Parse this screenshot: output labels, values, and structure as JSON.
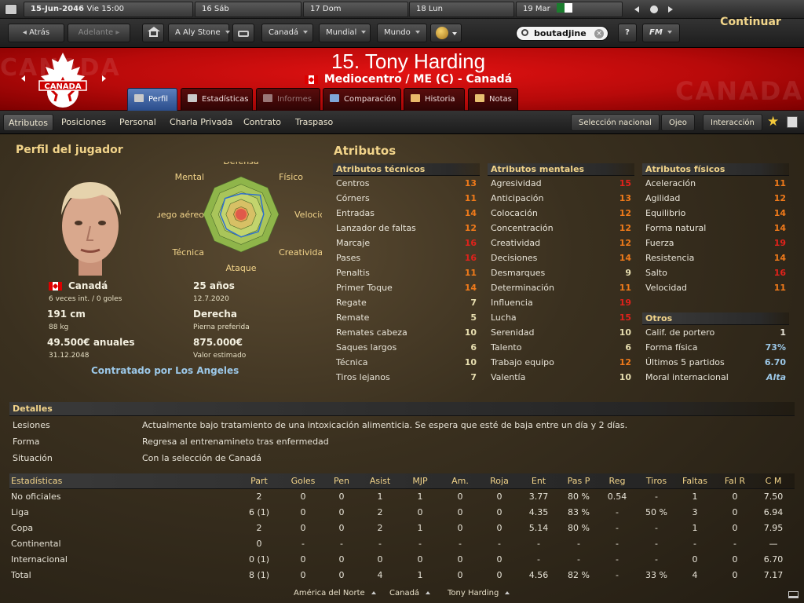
{
  "topbar": {
    "date": "15-Jun-2046",
    "day": "Vie 15:00",
    "days": [
      "16 Sáb",
      "17 Dom",
      "18 Lun",
      "19 Mar"
    ]
  },
  "nav": {
    "back": "Atrás",
    "forward": "Adelante",
    "manager": "A Aly Stone",
    "country": "Canadá",
    "world_cup": "Mundial",
    "world": "Mundo",
    "search_value": "boutadjine",
    "help": "?",
    "fm": "FM",
    "continue": "Continuar"
  },
  "player": {
    "title": "15. Tony Harding",
    "position": "Mediocentro / ME (C) - Canadá",
    "crest_text": "CANADA",
    "bg_text": "CANADA"
  },
  "tabs": [
    "Perfil",
    "Estadísticas",
    "Informes",
    "Comparación",
    "Historia",
    "Notas"
  ],
  "subnav": {
    "left": [
      "Atributos",
      "Posiciones",
      "Personal",
      "Charla Privada",
      "Contrato",
      "Traspaso"
    ],
    "right": [
      "Selección nacional",
      "Ojeo",
      "Interacción"
    ]
  },
  "profile": {
    "title": "Perfil del jugador",
    "nationality": "Canadá",
    "caps": "6 veces int. / 0 goles",
    "height": "191 cm",
    "weight": "88 kg",
    "wage": "49.500€ anuales",
    "contract_end": "31.12.2048",
    "age": "25 años",
    "dob": "12.7.2020",
    "foot": "Derecha",
    "foot_label": "Pierna preferida",
    "value": "875.000€",
    "value_label": "Valor estimado",
    "signed_by": "Contratado por Los Angeles"
  },
  "radar": {
    "labels": [
      "Defensa",
      "Físico",
      "Velocidad",
      "Creatividad",
      "Ataque",
      "Técnica",
      "Juego aéreo",
      "Mental"
    ],
    "values": [
      0.55,
      0.72,
      0.6,
      0.65,
      0.6,
      0.55,
      0.55,
      0.6
    ]
  },
  "attributes": {
    "title": "Atributos",
    "technical": {
      "title": "Atributos técnicos",
      "items": [
        [
          "Centros",
          "13"
        ],
        [
          "Córners",
          "11"
        ],
        [
          "Entradas",
          "14"
        ],
        [
          "Lanzador de faltas",
          "12"
        ],
        [
          "Marcaje",
          "16"
        ],
        [
          "Pases",
          "16"
        ],
        [
          "Penaltis",
          "11"
        ],
        [
          "Primer Toque",
          "14"
        ],
        [
          "Regate",
          "7"
        ],
        [
          "Remate",
          "5"
        ],
        [
          "Remates cabeza",
          "10"
        ],
        [
          "Saques largos",
          "6"
        ],
        [
          "Técnica",
          "10"
        ],
        [
          "Tiros lejanos",
          "7"
        ]
      ]
    },
    "mental": {
      "title": "Atributos mentales",
      "items": [
        [
          "Agresividad",
          "15"
        ],
        [
          "Anticipación",
          "13"
        ],
        [
          "Colocación",
          "12"
        ],
        [
          "Concentración",
          "12"
        ],
        [
          "Creatividad",
          "12"
        ],
        [
          "Decisiones",
          "14"
        ],
        [
          "Desmarques",
          "9"
        ],
        [
          "Determinación",
          "11"
        ],
        [
          "Influencia",
          "19"
        ],
        [
          "Lucha",
          "15"
        ],
        [
          "Serenidad",
          "10"
        ],
        [
          "Talento",
          "6"
        ],
        [
          "Trabajo equipo",
          "12"
        ],
        [
          "Valentía",
          "10"
        ]
      ]
    },
    "physical": {
      "title": "Atributos físicos",
      "items": [
        [
          "Aceleración",
          "11"
        ],
        [
          "Agilidad",
          "12"
        ],
        [
          "Equilibrio",
          "14"
        ],
        [
          "Forma natural",
          "14"
        ],
        [
          "Fuerza",
          "19"
        ],
        [
          "Resistencia",
          "14"
        ],
        [
          "Salto",
          "16"
        ],
        [
          "Velocidad",
          "11"
        ]
      ]
    },
    "other": {
      "title": "Otros",
      "items": [
        [
          "Calif. de portero",
          "1"
        ],
        [
          "Forma física",
          "73%"
        ],
        [
          "Últimos 5 partidos",
          "6.70"
        ],
        [
          "Moral internacional",
          "Alta"
        ]
      ]
    }
  },
  "details": {
    "title": "Detalles",
    "rows": [
      [
        "Lesiones",
        "Actualmente bajo tratamiento de una intoxicación alimenticia. Se espera que esté de baja entre un día y 2 días."
      ],
      [
        "Forma",
        "Regresa al entrenamineto tras enfermedad"
      ],
      [
        "Situación",
        "Con la selección de Canadá"
      ]
    ]
  },
  "stats": {
    "headers": [
      "Estadísticas",
      "Part",
      "Goles",
      "Pen",
      "Asist",
      "MJP",
      "Am.",
      "Roja",
      "Ent",
      "Pas P",
      "Reg",
      "Tiros",
      "Faltas",
      "Fal R",
      "C M"
    ],
    "rows": [
      [
        "No oficiales",
        "2",
        "0",
        "0",
        "1",
        "1",
        "0",
        "0",
        "3.77",
        "80 %",
        "0.54",
        "-",
        "1",
        "0",
        "7.50"
      ],
      [
        "Liga",
        "6 (1)",
        "0",
        "0",
        "2",
        "0",
        "0",
        "0",
        "4.35",
        "83 %",
        "-",
        "50 %",
        "3",
        "0",
        "6.94"
      ],
      [
        "Copa",
        "2",
        "0",
        "0",
        "2",
        "1",
        "0",
        "0",
        "5.14",
        "80 %",
        "-",
        "-",
        "1",
        "0",
        "7.95"
      ],
      [
        "Continental",
        "0",
        "-",
        "-",
        "-",
        "-",
        "-",
        "-",
        "-",
        "-",
        "-",
        "-",
        "-",
        "-",
        "—"
      ],
      [
        "Internacional",
        "0 (1)",
        "0",
        "0",
        "0",
        "0",
        "0",
        "0",
        "-",
        "-",
        "-",
        "-",
        "0",
        "0",
        "6.70"
      ],
      [
        "Total",
        "8 (1)",
        "0",
        "0",
        "4",
        "1",
        "0",
        "0",
        "4.56",
        "82 %",
        "-",
        "33 %",
        "4",
        "0",
        "7.17"
      ]
    ]
  },
  "breadcrumb": [
    "América del Norte",
    "Canadá",
    "Tony Harding"
  ],
  "colors": {
    "accent": "#f2d48a",
    "red_header": "#c40d0d",
    "tab_active": "#3d62a6",
    "high": "#e0221b",
    "mid": "#f07a1a",
    "low": "#e8dfb0"
  }
}
